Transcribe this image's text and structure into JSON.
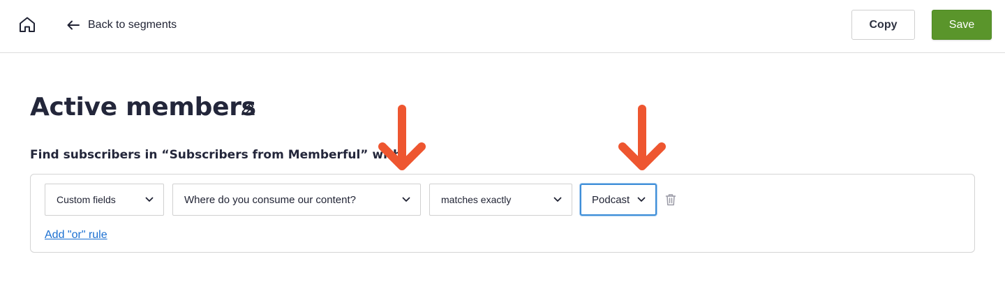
{
  "header": {
    "home_icon": "home-icon",
    "back_label": "Back to segments",
    "copy_label": "Copy",
    "save_label": "Save",
    "save_color": "#5a952b"
  },
  "segment": {
    "title": "Active members",
    "subtitle": "Find subscribers in “Subscribers from Memberful” with:"
  },
  "rule": {
    "field_type": "Custom fields",
    "field": "Where do you consume our content?",
    "operator": "matches exactly",
    "value": "Podcast",
    "add_or_label": "Add \"or\" rule"
  },
  "annotations": {
    "arrow_color": "#ee5630"
  }
}
